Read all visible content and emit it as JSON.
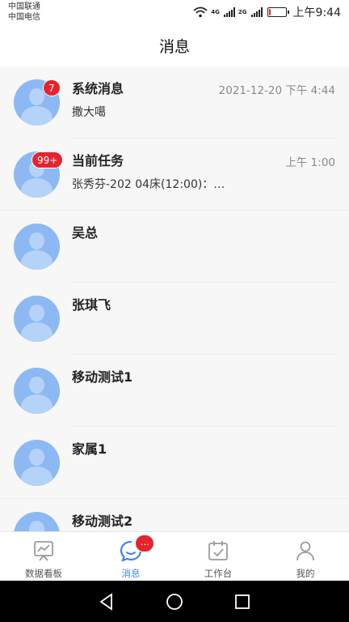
{
  "status_bar": {
    "carrier_1": "中国联通",
    "carrier_2": "中国电信",
    "net_1": "4G",
    "net_2": "2G",
    "time": "上午9:44",
    "battery_percent": 10,
    "battery_color": "#e02828"
  },
  "header": {
    "title": "消息"
  },
  "messages": [
    {
      "name": "系统消息",
      "preview": "撒大噶",
      "time": "2021-12-20 下午 4:44",
      "badge": "7"
    },
    {
      "name": "当前任务",
      "preview": "张秀芬-202 04床(12:00)：…",
      "time": "上午 1:00",
      "badge": "99+"
    },
    {
      "name": "吴总"
    },
    {
      "name": "张琪飞"
    },
    {
      "name": "移动测试1"
    },
    {
      "name": "家属1"
    },
    {
      "name": "移动测试2"
    }
  ],
  "tabs": [
    {
      "label": "数据看板",
      "icon": "dashboard-icon"
    },
    {
      "label": "消息",
      "icon": "chat-icon",
      "badge": "…"
    },
    {
      "label": "工作台",
      "icon": "calendar-check-icon"
    },
    {
      "label": "我的",
      "icon": "user-icon"
    }
  ],
  "colors": {
    "accent": "#3a83f3",
    "badge": "#e4242d",
    "avatar": "#8cb9f4"
  }
}
